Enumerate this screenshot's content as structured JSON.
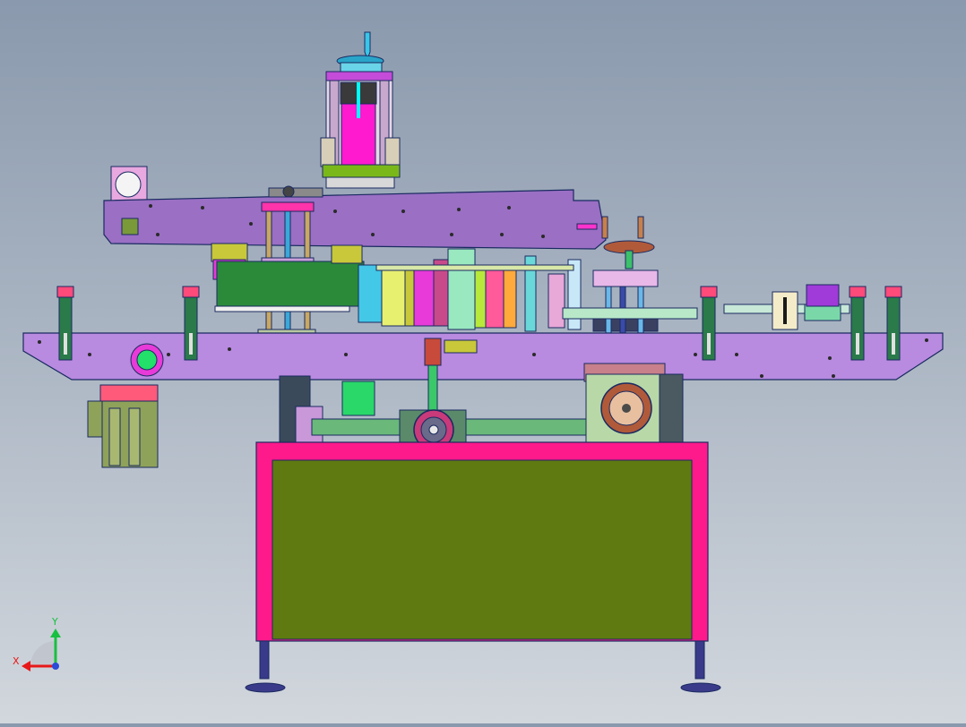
{
  "viewport": {
    "axis_triad": {
      "x_label": "X",
      "y_label": "Y"
    }
  },
  "colors": {
    "frame": "#ff1a8c",
    "panel": "#5f7a10",
    "plate": "#9a6fc4",
    "column": "#ff33cc",
    "motor": "#8fa25a",
    "sensor_green": "#22e06a"
  }
}
